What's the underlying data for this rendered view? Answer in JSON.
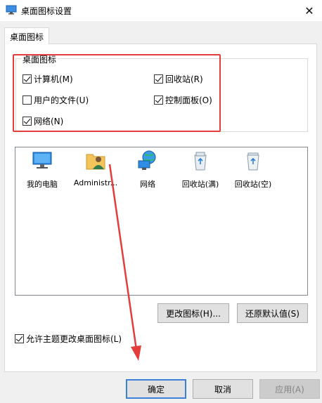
{
  "window": {
    "title": "桌面图标设置"
  },
  "tabs": [
    {
      "label": "桌面图标"
    }
  ],
  "group": {
    "title": "桌面图标",
    "checkboxes": [
      {
        "label": "计算机(M)",
        "checked": true
      },
      {
        "label": "回收站(R)",
        "checked": true
      },
      {
        "label": "用户的文件(U)",
        "checked": false
      },
      {
        "label": "控制面板(O)",
        "checked": true
      },
      {
        "label": "网络(N)",
        "checked": true
      }
    ]
  },
  "icons": [
    {
      "label": "我的电脑",
      "icon": "computer-icon"
    },
    {
      "label": "Administr...",
      "icon": "user-folder-icon"
    },
    {
      "label": "网络",
      "icon": "network-icon"
    },
    {
      "label": "回收站(满)",
      "icon": "recycle-bin-full-icon"
    },
    {
      "label": "回收站(空)",
      "icon": "recycle-bin-empty-icon"
    }
  ],
  "buttons": {
    "change_icon": "更改图标(H)...",
    "restore_default": "还原默认值(S)",
    "ok": "确定",
    "cancel": "取消",
    "apply": "应用(A)"
  },
  "allow_themes": {
    "label": "允许主题更改桌面图标(L)",
    "checked": true
  },
  "colors": {
    "annotation_red": "#e53c3c",
    "default_button_border": "#3c7fd6"
  }
}
